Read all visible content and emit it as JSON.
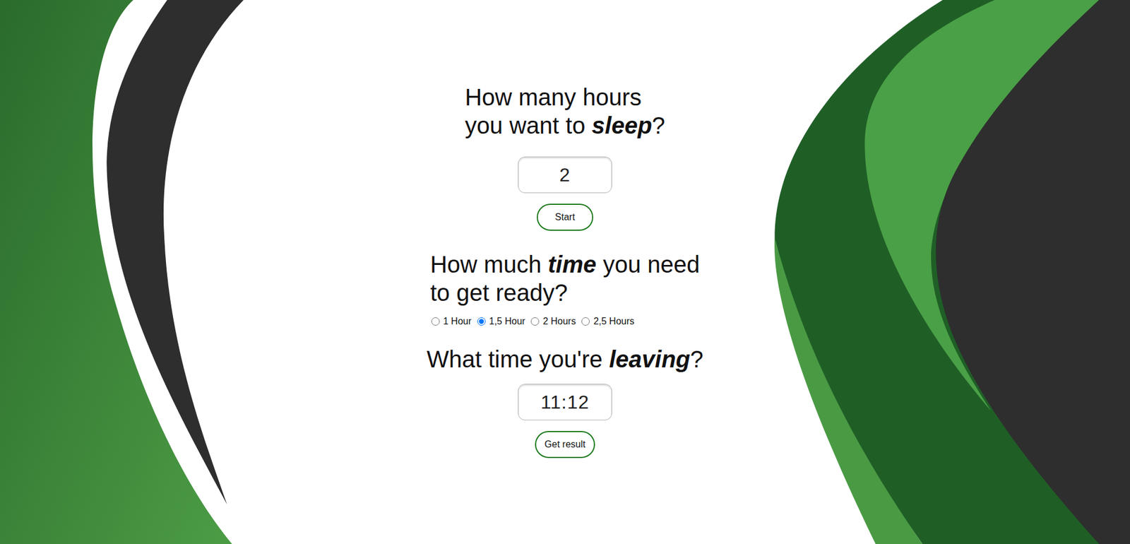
{
  "sleep": {
    "title": [
      [
        {
          "text": "How many hours",
          "em": false
        }
      ],
      [
        {
          "text": "you want to ",
          "em": false
        },
        {
          "text": "sleep",
          "em": true
        },
        {
          "text": "?",
          "em": false
        }
      ]
    ],
    "value": "2",
    "button": "Start"
  },
  "ready": {
    "title": [
      [
        {
          "text": "How much ",
          "em": false
        },
        {
          "text": "time",
          "em": true
        },
        {
          "text": " you need",
          "em": false
        }
      ],
      [
        {
          "text": "to get ready?",
          "em": false
        }
      ]
    ],
    "options": [
      {
        "label": "1 Hour",
        "selected": false
      },
      {
        "label": "1,5 Hour",
        "selected": true
      },
      {
        "label": "2 Hours",
        "selected": false
      },
      {
        "label": "2,5 Hours",
        "selected": false
      }
    ]
  },
  "leaving": {
    "title": [
      [
        {
          "text": "What time you're ",
          "em": false
        },
        {
          "text": "leaving",
          "em": true
        },
        {
          "text": "?",
          "em": false
        }
      ]
    ],
    "value": "11:12",
    "button": "Get result"
  }
}
